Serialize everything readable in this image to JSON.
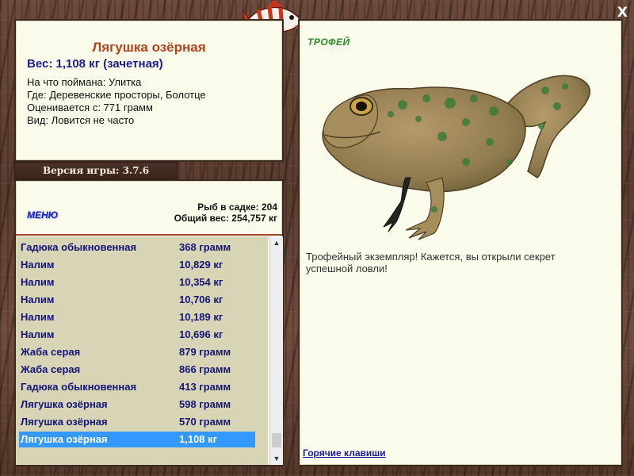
{
  "app": {
    "close_label": "X",
    "logo_icon": "fish-logo-icon"
  },
  "info": {
    "title": "Лягушка озёрная",
    "weight": "Вес: 1,108 кг (зачетная)",
    "details": [
      "На что поймана: Улитка",
      "Где: Деревенские просторы, Болотце",
      "Оценивается с: 771 грамм",
      "Вид: Ловится не часто"
    ]
  },
  "version": "Версия игры: 3.7.6",
  "list_panel": {
    "menu_label": "МЕНЮ",
    "fish_count": "Рыб в садке: 204",
    "total_weight": "Общий вес: 254,757 кг",
    "rows": [
      {
        "name": "Гадюка обыкновенная",
        "weight": "368 грамм"
      },
      {
        "name": "Налим",
        "weight": "10,829 кг"
      },
      {
        "name": "Налим",
        "weight": "10,354 кг"
      },
      {
        "name": "Налим",
        "weight": "10,706 кг"
      },
      {
        "name": "Налим",
        "weight": "10,189 кг"
      },
      {
        "name": "Налим",
        "weight": "10,696 кг"
      },
      {
        "name": "Жаба серая",
        "weight": "879 грамм"
      },
      {
        "name": "Жаба серая",
        "weight": "866 грамм"
      },
      {
        "name": "Гадюка обыкновенная",
        "weight": "413 грамм"
      },
      {
        "name": "Лягушка озёрная",
        "weight": "598 грамм"
      },
      {
        "name": "Лягушка озёрная",
        "weight": "570 грамм"
      },
      {
        "name": "Лягушка озёрная",
        "weight": "1,108 кг"
      }
    ],
    "selected_index": 11
  },
  "trophy": {
    "label": "ТРОФЕЙ",
    "text": "Трофейный экземпляр! Кажется, вы открыли секрет успешной ловли!",
    "image_icon": "frog-image",
    "hotkeys_label": "Горячие клавиши"
  },
  "colors": {
    "title": "#b2451f",
    "weight": "#1b1f8c",
    "list_text": "#151577",
    "selection": "#3399ff",
    "trophy_label": "#2c8a2c",
    "panel_bg": "#fbfbeb"
  }
}
